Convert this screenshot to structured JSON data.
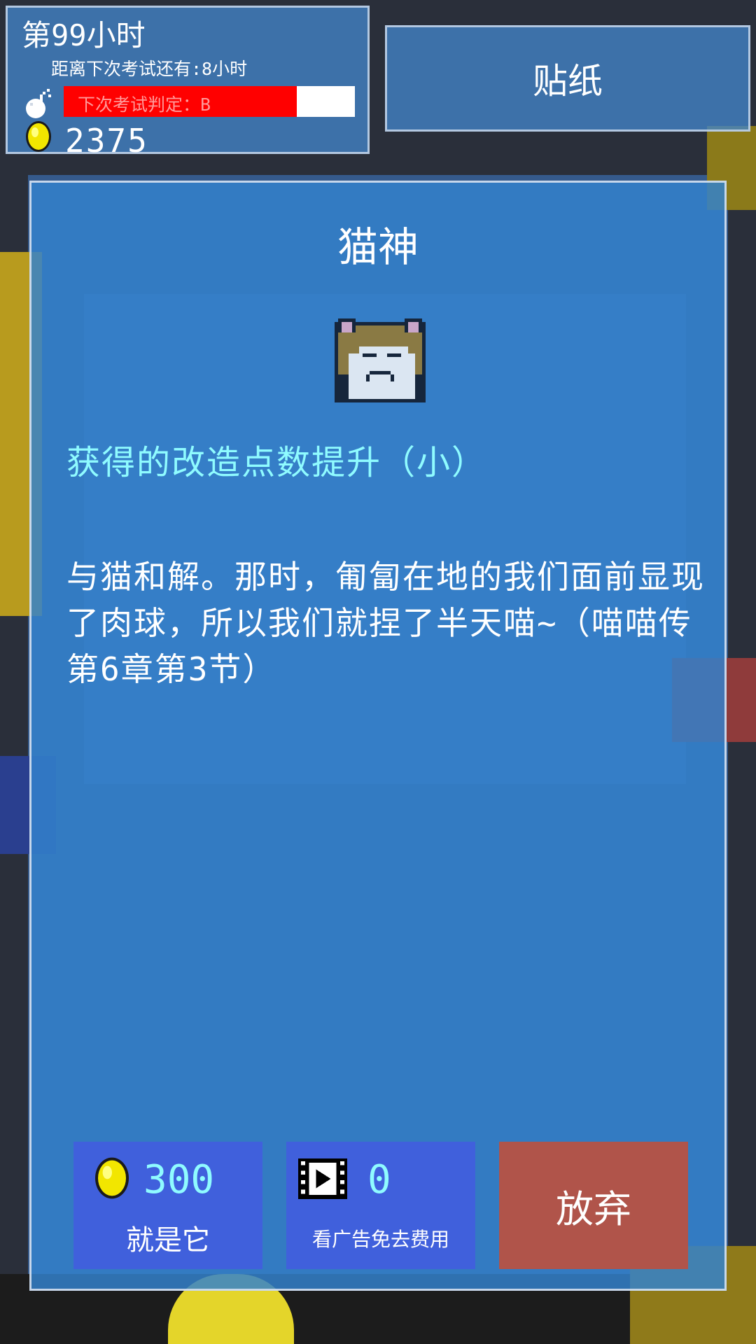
{
  "hud": {
    "hour_label": "第99小时",
    "countdown_label": "距离下次考试还有:8小时",
    "grade_label": "下次考试判定：B",
    "grade_progress": 0.8,
    "coins": "2375"
  },
  "sticker_button": {
    "label": "贴纸"
  },
  "dialog": {
    "title": "猫神",
    "effect": "获得的改造点数提升（小）",
    "description": "与猫和解。那时，匍匐在地的我们面前显现了肉球，所以我们就捏了半天喵~（喵喵传第6章第3节）"
  },
  "actions": {
    "buy": {
      "price": "300",
      "label": "就是它"
    },
    "ad": {
      "count": "0",
      "label": "看广告免去费用"
    },
    "quit": {
      "label": "放弃"
    }
  },
  "colors": {
    "panel": "#3382cd",
    "accent_cyan": "#8ffbff",
    "button_blue": "#4060dc",
    "button_red": "#b0544a",
    "grade_red": "#ff0000"
  },
  "icons": [
    "bomb-icon",
    "coin-icon",
    "cat-icon",
    "film-icon"
  ]
}
